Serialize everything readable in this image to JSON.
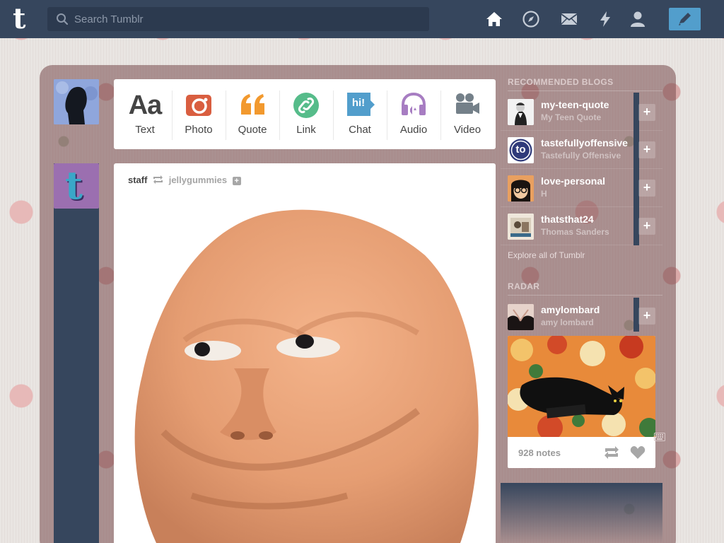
{
  "search": {
    "placeholder": "Search Tumblr"
  },
  "nav": {
    "home": "home-icon",
    "explore": "compass-icon",
    "inbox": "mail-icon",
    "activity": "lightning-icon",
    "account": "person-icon",
    "compose": "pencil-icon"
  },
  "post_types": [
    {
      "label": "Text",
      "icon_text": "Aa",
      "color": "#444444"
    },
    {
      "label": "Photo",
      "color": "#d95e40"
    },
    {
      "label": "Quote",
      "color": "#f2992e"
    },
    {
      "label": "Link",
      "color": "#56bc8a"
    },
    {
      "label": "Chat",
      "icon_text": "hi!",
      "color": "#529ecc"
    },
    {
      "label": "Audio",
      "color": "#a77dc2"
    },
    {
      "label": "Video",
      "color": "#748089"
    }
  ],
  "post": {
    "author": "staff",
    "source": "jellygummies",
    "follow": "+"
  },
  "recommended": {
    "title": "RECOMMENDED BLOGS",
    "blogs": [
      {
        "name": "my-teen-quote",
        "title": "My Teen Quote"
      },
      {
        "name": "tastefullyoffensive",
        "title": "Tastefully Offensive",
        "avatar_text": "to"
      },
      {
        "name": "love-personal",
        "title": "H"
      },
      {
        "name": "thatsthat24",
        "title": "Thomas Sanders"
      }
    ],
    "follow_label": "+",
    "explore": "Explore all of Tumblr"
  },
  "radar": {
    "title": "RADAR",
    "blog": {
      "name": "amylombard",
      "title": "amy lombard"
    },
    "notes": "928 notes"
  },
  "colors": {
    "navy": "#36465d",
    "accent": "#529ecc"
  }
}
